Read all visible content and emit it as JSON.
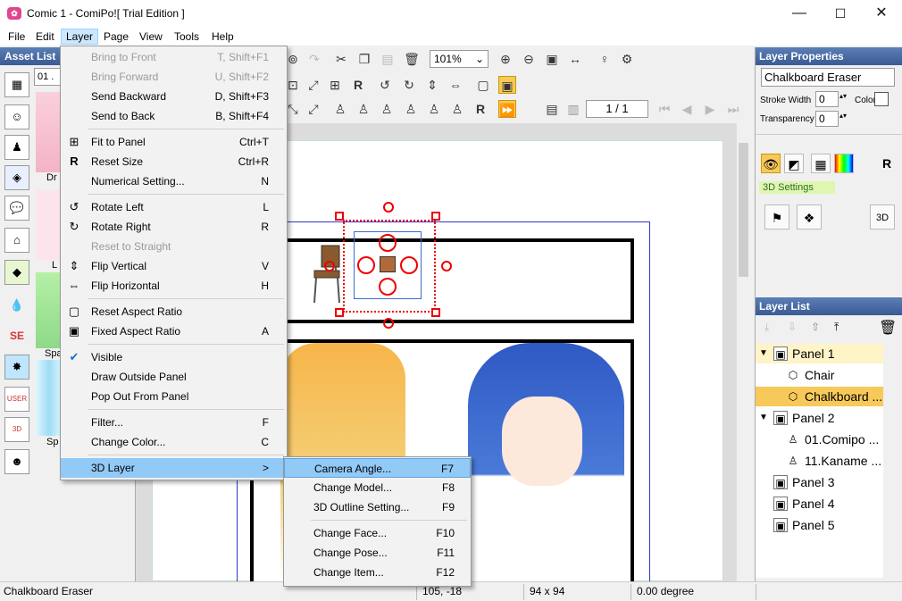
{
  "window": {
    "title": "Comic 1 - ComiPo![ Trial Edition ]",
    "app_icon": "comipo-app-icon",
    "minimize": "—",
    "maximize": "☐",
    "close": "✕"
  },
  "menubar": {
    "items": [
      "File",
      "Edit",
      "Layer",
      "Page",
      "View",
      "Tools",
      "Help"
    ],
    "active": "Layer"
  },
  "asset_list": {
    "title": "Asset List",
    "dropdown_value": "01 .",
    "thumb_labels": [
      "Dr",
      "L",
      "Spa",
      "Sp"
    ]
  },
  "toolbar": {
    "zoom_value": "101%",
    "page_value": "1 / 1"
  },
  "layer_menu": {
    "items": [
      {
        "label": "Bring to Front",
        "key": "T, Shift+F1",
        "disabled": true,
        "icon": ""
      },
      {
        "label": "Bring Forward",
        "key": "U, Shift+F2",
        "disabled": true,
        "icon": ""
      },
      {
        "label": "Send Backward",
        "key": "D, Shift+F3",
        "disabled": false,
        "icon": ""
      },
      {
        "label": "Send to Back",
        "key": "B, Shift+F4",
        "disabled": false,
        "icon": ""
      },
      {
        "label": "Fit to Panel",
        "key": "Ctrl+T",
        "disabled": false,
        "icon": "fit-icon"
      },
      {
        "label": "Reset Size",
        "key": "Ctrl+R",
        "disabled": false,
        "icon": "reset-icon"
      },
      {
        "label": "Numerical Setting...",
        "key": "N",
        "disabled": false,
        "icon": ""
      },
      {
        "label": "Rotate Left",
        "key": "L",
        "disabled": false,
        "icon": "rotate-left-icon"
      },
      {
        "label": "Rotate Right",
        "key": "R",
        "disabled": false,
        "icon": "rotate-right-icon"
      },
      {
        "label": "Reset to Straight",
        "key": "",
        "disabled": true,
        "icon": ""
      },
      {
        "label": "Flip Vertical",
        "key": "V",
        "disabled": false,
        "icon": "flip-vertical-icon"
      },
      {
        "label": "Flip Horizontal",
        "key": "H",
        "disabled": false,
        "icon": "flip-horizontal-icon"
      },
      {
        "label": "Reset Aspect Ratio",
        "key": "",
        "disabled": false,
        "icon": "aspect-reset-icon"
      },
      {
        "label": "Fixed Aspect Ratio",
        "key": "A",
        "disabled": false,
        "icon": "aspect-fixed-icon"
      },
      {
        "label": "Visible",
        "key": "",
        "disabled": false,
        "icon": "checkmark-icon"
      },
      {
        "label": "Draw Outside Panel",
        "key": "",
        "disabled": false,
        "icon": ""
      },
      {
        "label": "Pop Out From Panel",
        "key": "",
        "disabled": false,
        "icon": ""
      },
      {
        "label": "Filter...",
        "key": "F",
        "disabled": false,
        "icon": ""
      },
      {
        "label": "Change Color...",
        "key": "C",
        "disabled": false,
        "icon": ""
      },
      {
        "label": "3D Layer",
        "key": "",
        "disabled": false,
        "icon": "",
        "submenu_arrow": ">"
      }
    ]
  },
  "submenu_3d": {
    "items": [
      {
        "label": "Camera Angle...",
        "key": "F7"
      },
      {
        "label": "Change Model...",
        "key": "F8"
      },
      {
        "label": "3D Outline Setting...",
        "key": "F9"
      },
      {
        "label": "Change Face...",
        "key": "F10"
      },
      {
        "label": "Change Pose...",
        "key": "F11"
      },
      {
        "label": "Change Item...",
        "key": "F12"
      }
    ]
  },
  "layer_properties": {
    "title": "Layer Properties",
    "name_value": "Chalkboard Eraser",
    "stroke_width_label": "Stroke Width",
    "stroke_width_value": "0",
    "color_label": "Color",
    "transparency_label": "Transparency",
    "transparency_value": "0",
    "settings_3d_label": "3D Settings"
  },
  "layer_list": {
    "title": "Layer List",
    "rows": [
      {
        "label": "Panel 1",
        "level": 0,
        "expanded": true,
        "selected": "light"
      },
      {
        "label": "Chair",
        "level": 1,
        "selected": ""
      },
      {
        "label": "Chalkboard ...",
        "level": 1,
        "selected": "strong"
      },
      {
        "label": "Panel 2",
        "level": 0,
        "expanded": true,
        "selected": ""
      },
      {
        "label": "01.Comipo ...",
        "level": 1,
        "selected": ""
      },
      {
        "label": "11.Kaname ...",
        "level": 1,
        "selected": ""
      },
      {
        "label": "Panel 3",
        "level": 0,
        "selected": ""
      },
      {
        "label": "Panel 4",
        "level": 0,
        "selected": ""
      },
      {
        "label": "Panel 5",
        "level": 0,
        "selected": ""
      }
    ]
  },
  "statusbar": {
    "object": "Chalkboard Eraser",
    "position": "105, -18",
    "size": "94 x 94",
    "angle": "0.00 degree"
  },
  "colors": {
    "header_blue": "#3a5a94",
    "menu_highlight": "#91c9f7",
    "selection_red": "#e00000",
    "layer_selected": "#f7c95a",
    "layer_light_selected": "#fff4c8"
  }
}
